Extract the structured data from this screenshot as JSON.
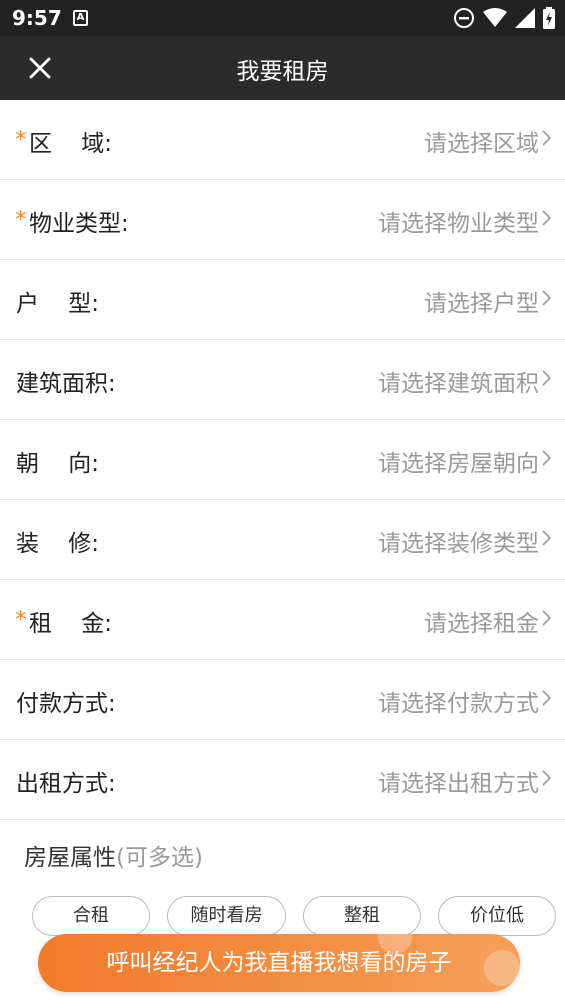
{
  "status_bar": {
    "time": "9:57",
    "notification_badge": "A",
    "icons": [
      "dnd-icon",
      "wifi-icon",
      "signal-icon",
      "battery-icon"
    ]
  },
  "nav": {
    "title": "我要租房",
    "close_icon": "close-icon"
  },
  "form": {
    "rows": [
      {
        "label": "区    域:",
        "required": true,
        "placeholder": "请选择区域"
      },
      {
        "label": "物业类型:",
        "required": true,
        "placeholder": "请选择物业类型"
      },
      {
        "label": "户    型:",
        "required": false,
        "placeholder": "请选择户型"
      },
      {
        "label": "建筑面积:",
        "required": false,
        "placeholder": "请选择建筑面积"
      },
      {
        "label": "朝    向:",
        "required": false,
        "placeholder": "请选择房屋朝向"
      },
      {
        "label": "装    修:",
        "required": false,
        "placeholder": "请选择装修类型"
      },
      {
        "label": "租    金:",
        "required": true,
        "placeholder": "请选择租金"
      },
      {
        "label": "付款方式:",
        "required": false,
        "placeholder": "请选择付款方式"
      },
      {
        "label": "出租方式:",
        "required": false,
        "placeholder": "请选择出租方式"
      }
    ],
    "required_mark": "*"
  },
  "attributes": {
    "title": "房屋属性",
    "hint": "(可多选)",
    "tags": [
      "合租",
      "随时看房",
      "整租",
      "价位低"
    ]
  },
  "call_button": {
    "label": "呼叫经纪人为我直播我想看的房子"
  },
  "colors": {
    "accent": "#f08a34",
    "nav_bg": "#2b2b2b",
    "placeholder": "#9a9a9a"
  }
}
